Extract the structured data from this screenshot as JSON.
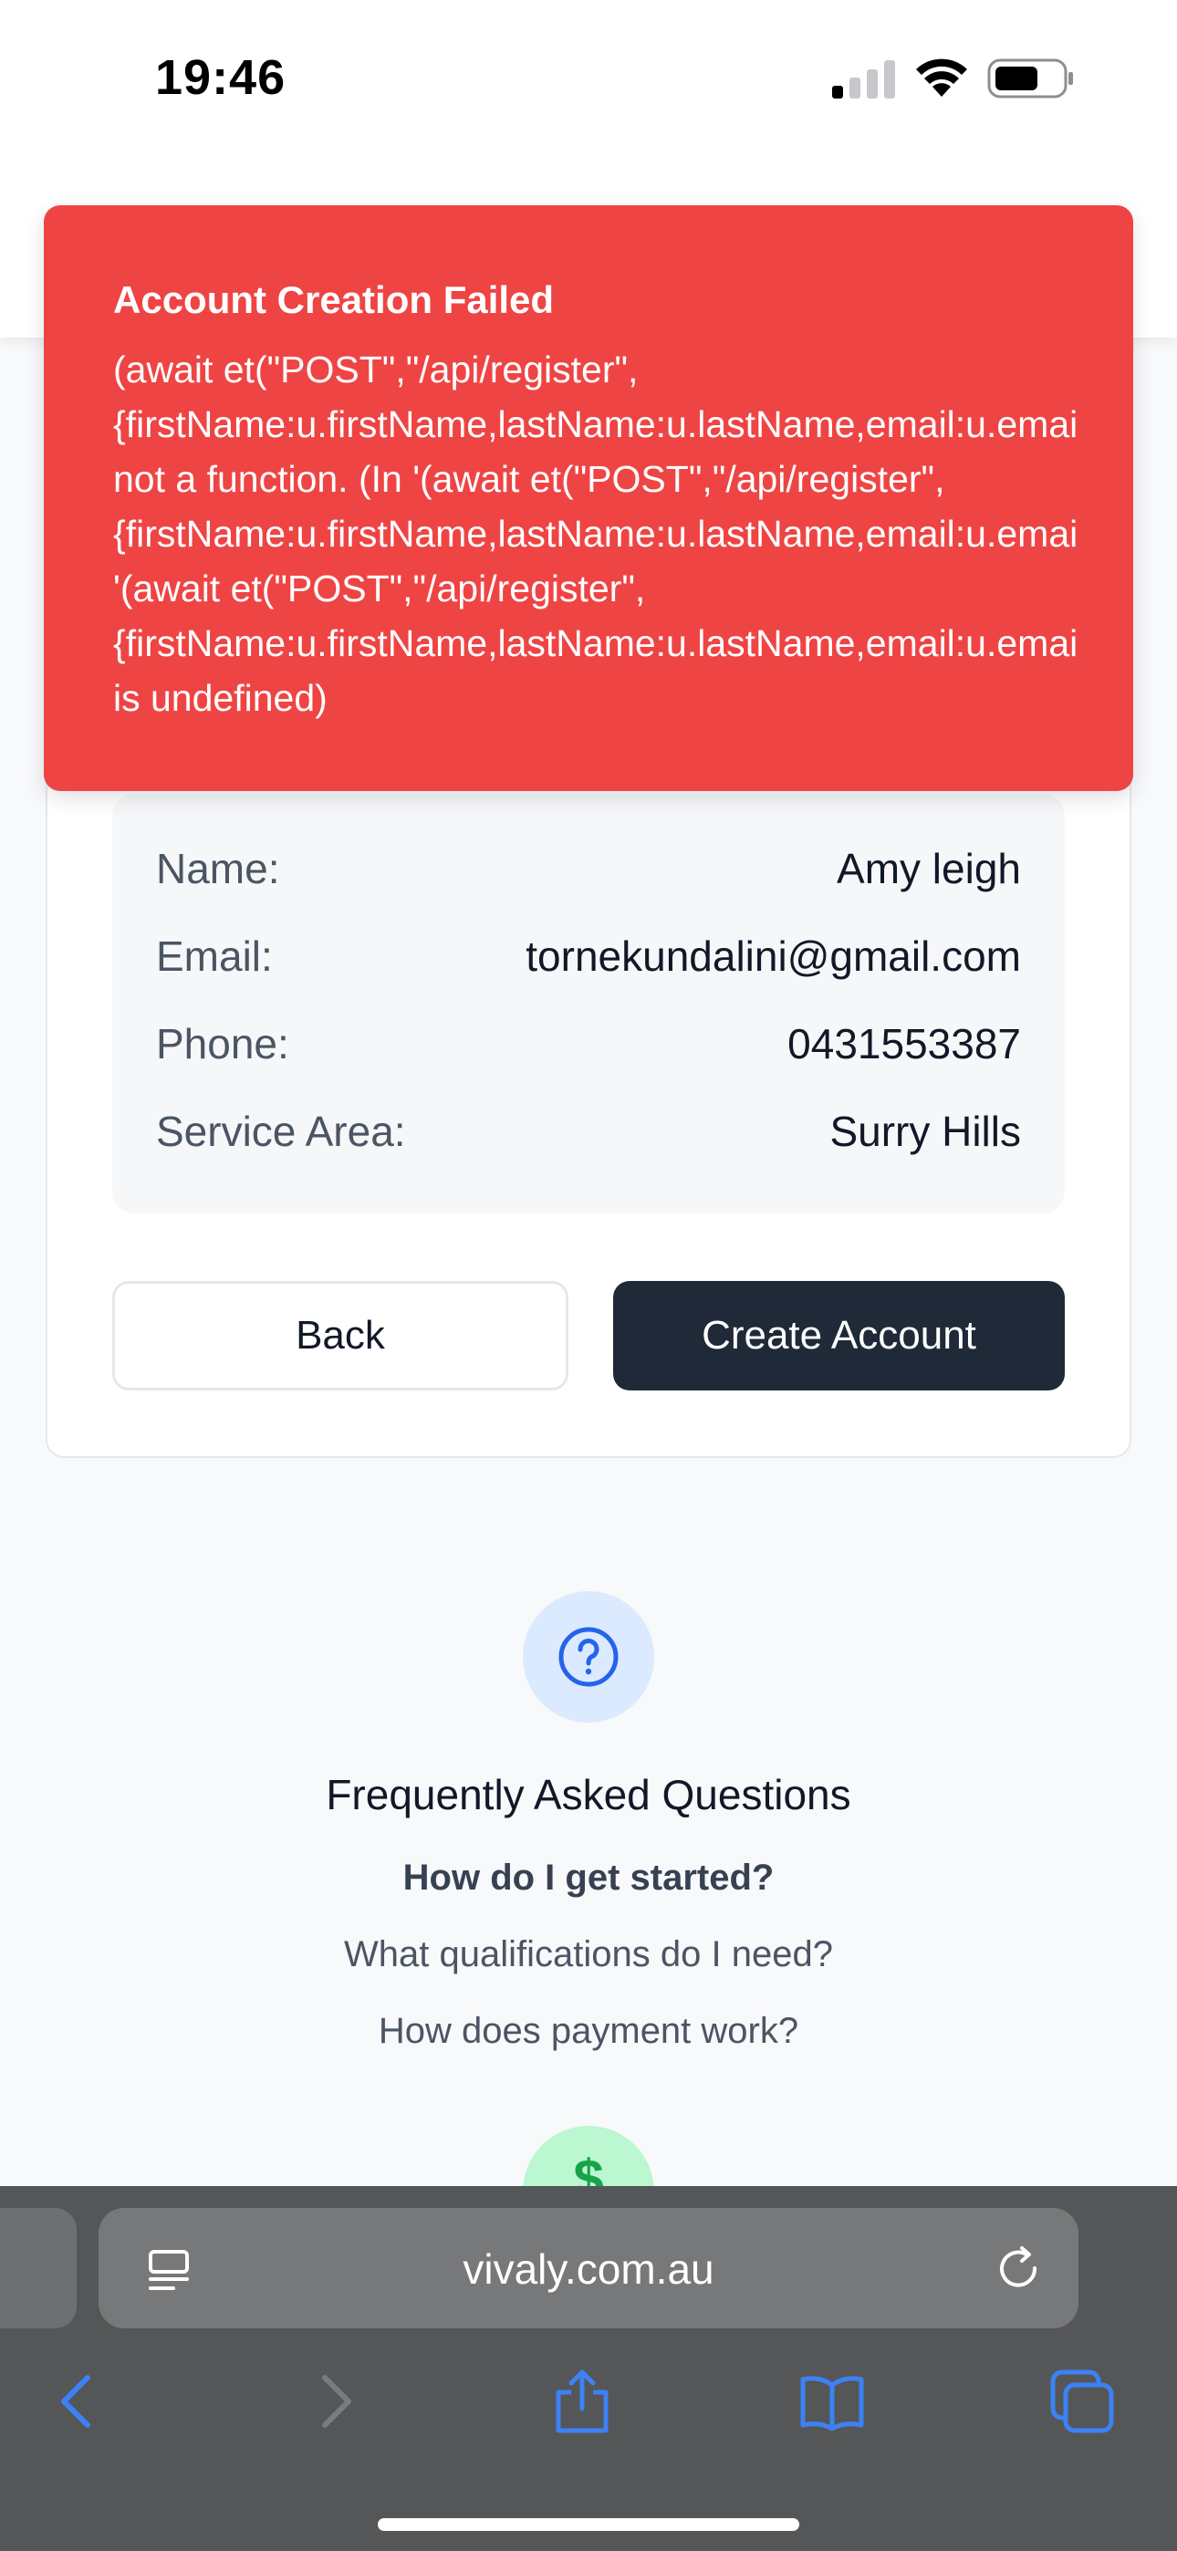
{
  "status_bar": {
    "time": "19:46",
    "signal_icon": "cellular-signal-icon",
    "wifi_icon": "wifi-icon",
    "battery_icon": "battery-icon"
  },
  "toast": {
    "title": "Account Creation Failed",
    "lines": [
      "(await et(\"POST\",\"/api/register\",",
      "{firstName:u.firstName,lastName:u.lastName,email:u.emai",
      "not a function. (In '(await et(\"POST\",\"/api/register\",",
      "{firstName:u.firstName,lastName:u.lastName,email:u.emai",
      "'(await et(\"POST\",\"/api/register\",",
      "{firstName:u.firstName,lastName:u.lastName,email:u.emai",
      "is undefined)"
    ],
    "color": "#ef4444"
  },
  "summary": {
    "rows": [
      {
        "label": "Name:",
        "value": "Amy leigh"
      },
      {
        "label": "Email:",
        "value": "tornekundalini@gmail.com"
      },
      {
        "label": "Phone:",
        "value": "0431553387"
      },
      {
        "label": "Service Area:",
        "value": "Surry Hills"
      }
    ]
  },
  "actions": {
    "back_label": "Back",
    "create_label": "Create Account",
    "create_color": "#1f2937"
  },
  "faq": {
    "icon": "question-circle-icon",
    "title": "Frequently Asked Questions",
    "questions": [
      "How do I get started?",
      "What qualifications do I need?",
      "How does payment work?"
    ],
    "next_icon": "dollar-icon"
  },
  "browser": {
    "url": "vivaly.com.au",
    "reader_icon": "reader-mode-icon",
    "reload_icon": "reload-icon",
    "nav": [
      "back-icon",
      "forward-icon",
      "share-icon",
      "bookmarks-icon",
      "tabs-icon"
    ],
    "accent": "#3b82f6"
  }
}
